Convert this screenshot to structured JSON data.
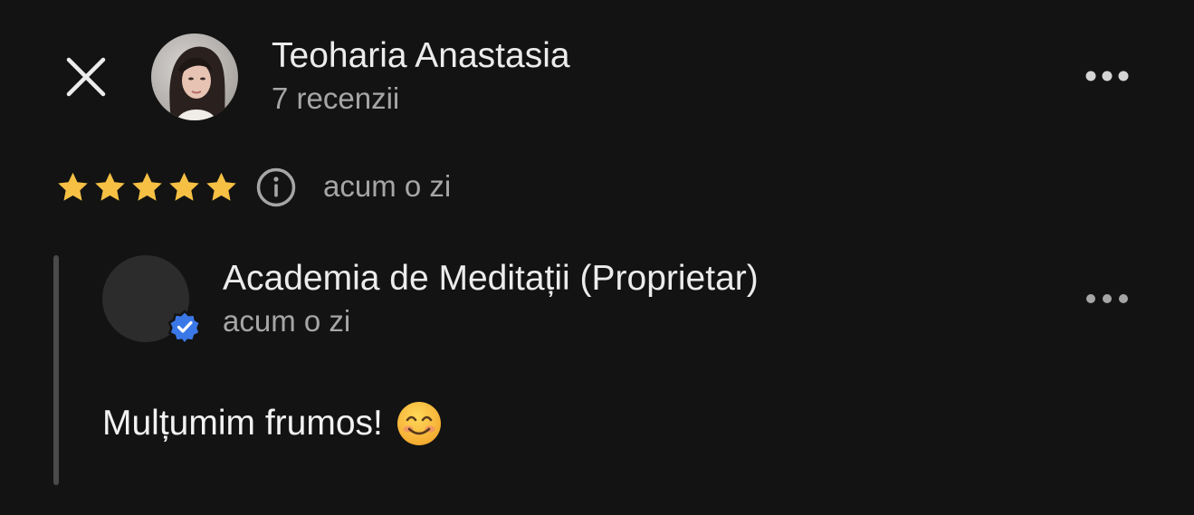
{
  "review": {
    "reviewer_name": "Teoharia Anastasia",
    "reviewer_count": "7 recenzii",
    "rating": 5,
    "rating_max": 5,
    "time": "acum o zi"
  },
  "reply": {
    "owner_name": "Academia de Meditații (Proprietar)",
    "time": "acum o zi",
    "text": "Mulțumim frumos!",
    "emoji": "smiling-face-emoji"
  },
  "icons": {
    "close": "close-icon",
    "more": "more-horizontal-icon",
    "info": "info-icon",
    "star": "star-icon",
    "verified": "verified-badge-icon"
  },
  "colors": {
    "background": "#131313",
    "star": "#f5c044",
    "verified": "#3b78e7",
    "secondary_text": "#a6a6a6"
  }
}
